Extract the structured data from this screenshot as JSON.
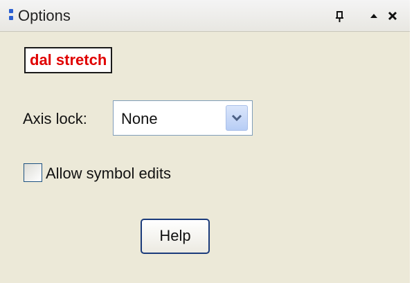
{
  "panel": {
    "title": "Options",
    "title_icons": {
      "grip": "grip-icon",
      "pin": "pin-icon",
      "collapse": "collapse-arrow-icon",
      "close": "close-icon"
    }
  },
  "tool_label": "dal stretch",
  "axis_lock": {
    "label": "Axis lock:",
    "value": "None"
  },
  "allow_symbol_edits": {
    "label": "Allow symbol edits",
    "checked": false
  },
  "help_button": {
    "label": "Help"
  },
  "colors": {
    "panel_bg": "#ece9d8",
    "tool_label_text": "#e00000",
    "grip_accent": "#2b5fd1",
    "combo_button": "#b7cdf5"
  }
}
